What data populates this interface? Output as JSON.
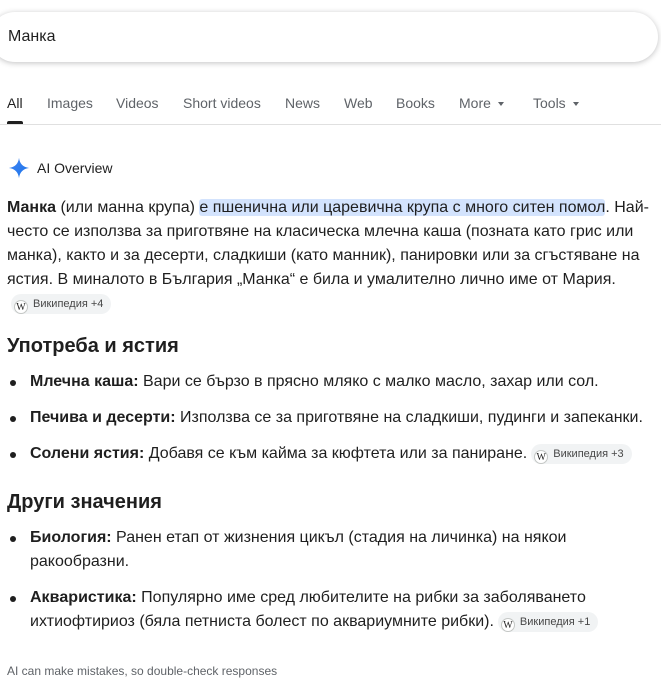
{
  "search": {
    "value": "Манка"
  },
  "tabs": [
    {
      "label": "All",
      "active": true
    },
    {
      "label": "Images"
    },
    {
      "label": "Videos"
    },
    {
      "label": "Short videos"
    },
    {
      "label": "News"
    },
    {
      "label": "Web"
    },
    {
      "label": "Books"
    },
    {
      "label": "More",
      "dropdown": true
    },
    {
      "label": "Tools",
      "dropdown": true
    }
  ],
  "ai_overview": {
    "icon": "sparkle-icon",
    "title": "AI Overview",
    "intro": {
      "term": "Манка",
      "after_term": " (или манна крупа) ",
      "highlight": "е пшенична или царевична крупа с много ситен помол",
      "rest": ". Най-често се използва за приготвяне на класическа млечна каша (позната като грис или манка), както и за десерти, сладкиши (като манник), панировки или за сгъстяване на ястия. В миналото в България „Манка“ е била и умалително лично име от Мария.",
      "source": "Википедия +4"
    },
    "sections": [
      {
        "heading": "Употреба и ястия",
        "items": [
          {
            "term": "Млечна каша:",
            "text": " Вари се бързо в прясно мляко с малко масло, захар или сол."
          },
          {
            "term": "Печива и десерти:",
            "text": " Използва се за приготвяне на сладкиши, пудинги и запеканки."
          },
          {
            "term": "Солени ястия:",
            "text": " Добавя се към кайма за кюфтета или за паниране.",
            "source": "Википедия +3"
          }
        ]
      },
      {
        "heading": "Други значения",
        "items": [
          {
            "term": "Биология:",
            "text": " Ранен етап от жизнения цикъл (стадия на личинка) на някои ракообразни."
          },
          {
            "term": "Аквaристика:",
            "text": " Популярно име сред любителите на рибки за заболяването ихтиофтириоз (бяла петниста болест по аквариумните рибки).",
            "source": "Википедия +1"
          }
        ]
      }
    ],
    "wiki_logo": "W",
    "footer": "AI can make mistakes, so double-check responses"
  },
  "colors": {
    "highlight": "#d3e3fd",
    "sparkle": "#4285f4",
    "text": "#1f1f1f",
    "muted": "#5f6368"
  }
}
